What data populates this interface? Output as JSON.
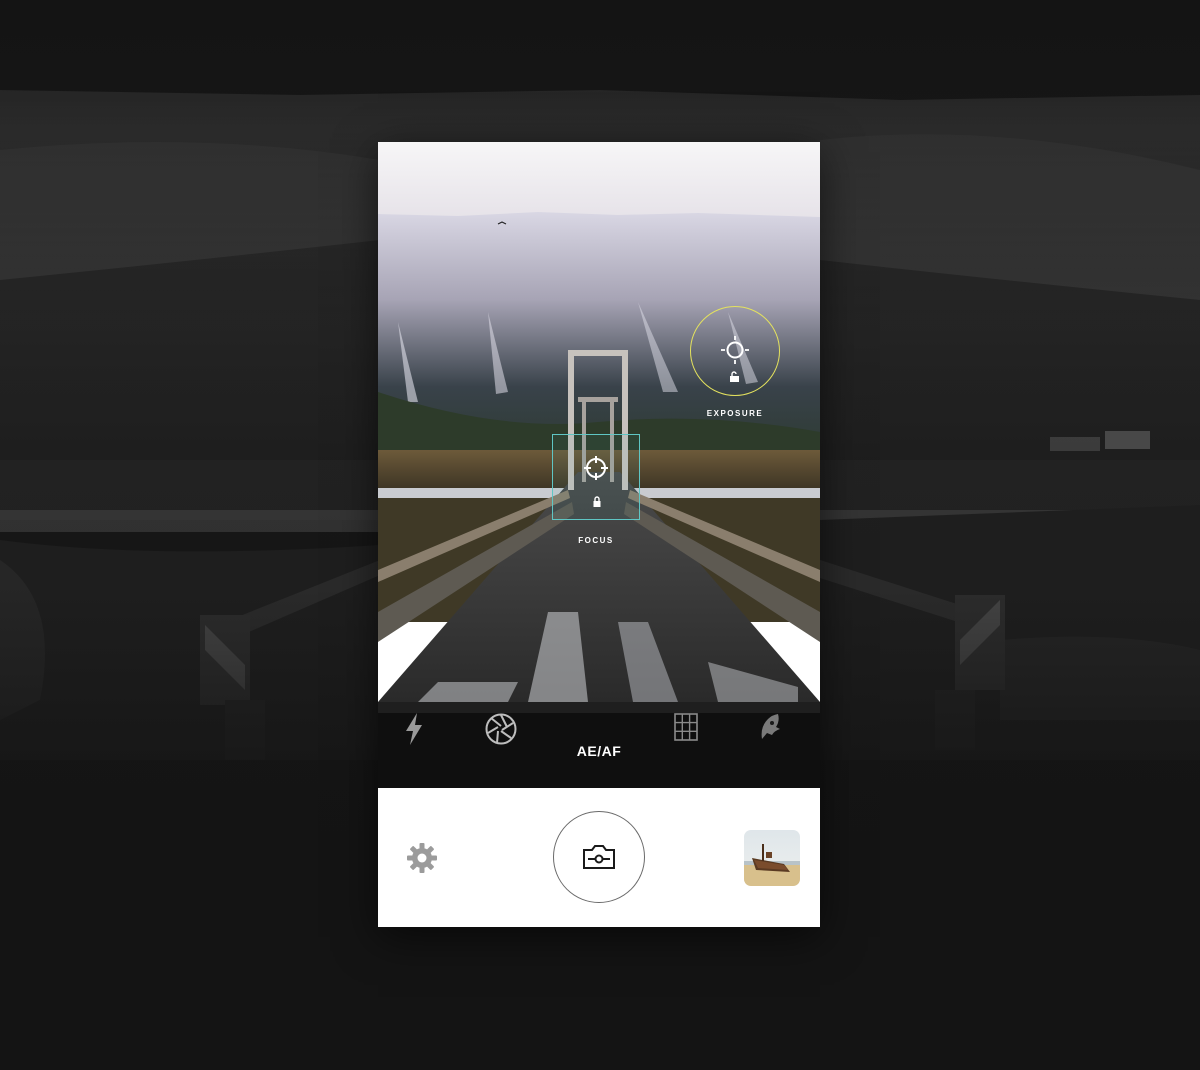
{
  "camera": {
    "focus_label": "FOCUS",
    "exposure_label": "EXPOSURE",
    "toolbar": {
      "aeaf_label": "AE/AF",
      "icons": [
        "flash-icon",
        "aperture-icon",
        "grid-icon",
        "ghost-icon"
      ]
    },
    "controls": {
      "icons": [
        "gear-icon",
        "camera-icon",
        "gallery-thumbnail"
      ]
    }
  },
  "colors": {
    "focus_reticle": "#5fc6c4",
    "exposure_reticle": "#e4e25e",
    "toolbar_bg": "#0a0a0a",
    "controls_bg": "#ffffff",
    "page_bg": "#151515"
  }
}
